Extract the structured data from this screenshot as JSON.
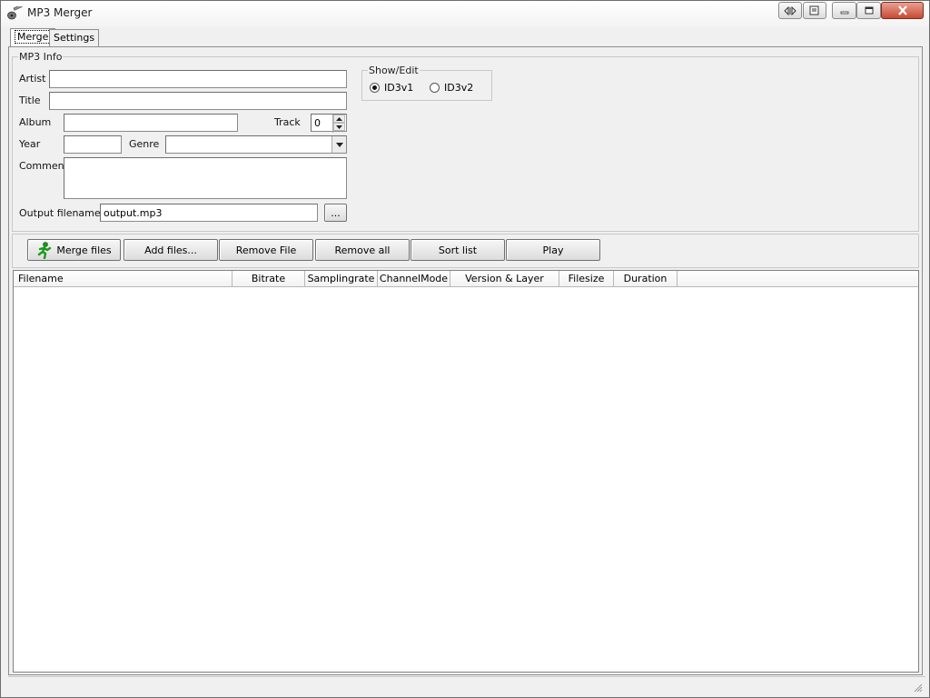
{
  "window": {
    "title": "MP3 Merger",
    "icons": {
      "app": "guitar-icon",
      "aero_peek": "aero-peek-icon",
      "sheet": "sheet-icon",
      "minimize": "minimize-icon",
      "maximize": "maximize-icon",
      "close": "close-icon"
    }
  },
  "tabs": [
    {
      "label": "Merge",
      "active": true
    },
    {
      "label": "Settings",
      "active": false
    }
  ],
  "mp3_info": {
    "legend": "MP3 Info",
    "artist_label": "Artist",
    "artist_value": "",
    "title_label": "Title",
    "title_value": "",
    "album_label": "Album",
    "album_value": "",
    "track_label": "Track",
    "track_value": "0",
    "year_label": "Year",
    "year_value": "",
    "genre_label": "Genre",
    "genre_value": "",
    "comment_label": "Comment",
    "comment_value": "",
    "output_label": "Output filename",
    "output_value": "output.mp3",
    "browse_label": "..."
  },
  "show_edit": {
    "legend": "Show/Edit",
    "options": [
      {
        "label": "ID3v1",
        "selected": true
      },
      {
        "label": "ID3v2",
        "selected": false
      }
    ]
  },
  "buttons": {
    "merge_files": "Merge files",
    "merge_icon": "running-man-icon",
    "add_files": "Add files...",
    "remove_file": "Remove File",
    "remove_all": "Remove all",
    "sort_list": "Sort list",
    "play": "Play"
  },
  "file_list": {
    "columns": [
      "Filename",
      "Bitrate",
      "Samplingrate",
      "ChannelMode",
      "Version & Layer",
      "Filesize",
      "Duration"
    ],
    "rows": []
  },
  "colors": {
    "window_bg": "#f0f0f0",
    "close_button": "#c74a33",
    "merge_icon": "#1a9a1a"
  }
}
